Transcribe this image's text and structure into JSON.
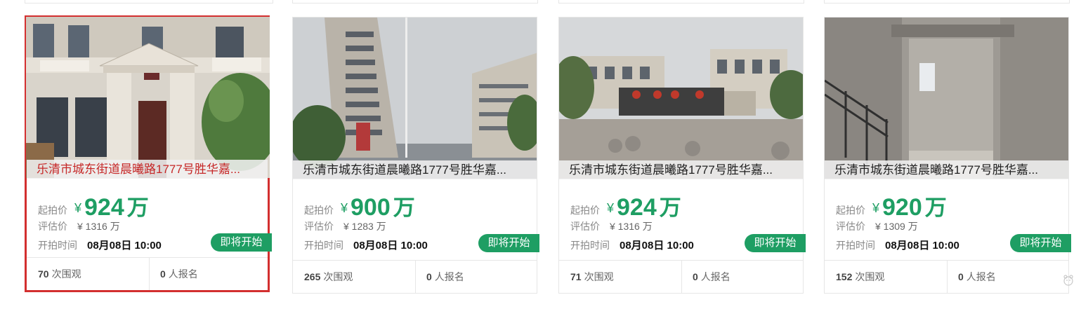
{
  "listings": [
    {
      "title": "乐清市城东街道晨曦路1777号胜华嘉...",
      "start_label": "起拍价",
      "start_currency": "¥",
      "start_price": "924",
      "start_unit": "万",
      "eval_label": "评估价",
      "eval_price": "¥ 1316 万",
      "time_label": "开拍时间",
      "time": "08月08日 10:00",
      "status": "即将开始",
      "views": "70",
      "views_label": "次围观",
      "signups": "0",
      "signups_label": "人报名"
    },
    {
      "title": "乐清市城东街道晨曦路1777号胜华嘉...",
      "start_label": "起拍价",
      "start_currency": "¥",
      "start_price": "900",
      "start_unit": "万",
      "eval_label": "评估价",
      "eval_price": "¥ 1283 万",
      "time_label": "开拍时间",
      "time": "08月08日 10:00",
      "status": "即将开始",
      "views": "265",
      "views_label": "次围观",
      "signups": "0",
      "signups_label": "人报名"
    },
    {
      "title": "乐清市城东街道晨曦路1777号胜华嘉...",
      "start_label": "起拍价",
      "start_currency": "¥",
      "start_price": "924",
      "start_unit": "万",
      "eval_label": "评估价",
      "eval_price": "¥ 1316 万",
      "time_label": "开拍时间",
      "time": "08月08日 10:00",
      "status": "即将开始",
      "views": "71",
      "views_label": "次围观",
      "signups": "0",
      "signups_label": "人报名"
    },
    {
      "title": "乐清市城东街道晨曦路1777号胜华嘉...",
      "start_label": "起拍价",
      "start_currency": "¥",
      "start_price": "920",
      "start_unit": "万",
      "eval_label": "评估价",
      "eval_price": "¥ 1309 万",
      "time_label": "开拍时间",
      "time": "08月08日 10:00",
      "status": "即将开始",
      "views": "152",
      "views_label": "次围观",
      "signups": "0",
      "signups_label": "人报名"
    }
  ],
  "colors": {
    "accent": "#1e9e63",
    "highlight": "#d32f2f"
  },
  "icons": {
    "scroll_helper": "cartoon-animal-icon"
  }
}
